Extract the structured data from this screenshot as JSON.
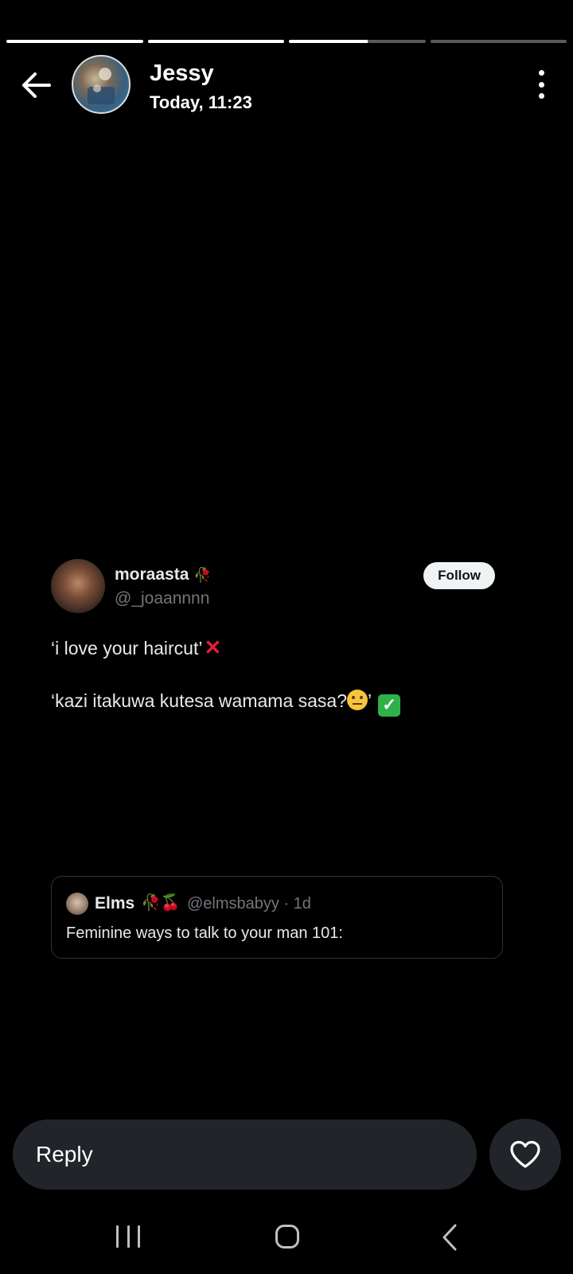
{
  "progress_segments": [
    {
      "fill": 1.0
    },
    {
      "fill": 1.0
    },
    {
      "fill": 0.58
    },
    {
      "fill": 0.0
    }
  ],
  "header": {
    "back_icon": "arrow-left-icon",
    "name": "Jessy",
    "time": "Today, 11:23",
    "more_icon": "more-vertical-icon"
  },
  "tweet": {
    "name": "moraasta",
    "name_emoji": "🥀",
    "handle": "@_joaannnn",
    "follow_label": "Follow",
    "line1_text": "‘i love your haircut’",
    "line1_emoji": "✕",
    "line2_text": "‘kazi itakuwa kutesa wamama sasa?",
    "line2_quote_close": "’",
    "line2_check": "✓",
    "quote": {
      "name": "Elms",
      "name_emoji": "🥀🍒",
      "handle": "@elmsbabyy · 1d",
      "text": "Feminine ways to talk to your man 101:"
    }
  },
  "reply": {
    "placeholder": "Reply",
    "like_icon": "heart-outline-icon"
  },
  "navbar": {
    "recents_icon": "recents-icon",
    "home_icon": "home-icon",
    "back_icon": "nav-back-icon"
  },
  "colors": {
    "background": "#000000",
    "reply_bg": "#212529",
    "handle_gray": "#71767b",
    "x_red": "#e0203a",
    "check_green": "#2fb14a"
  }
}
